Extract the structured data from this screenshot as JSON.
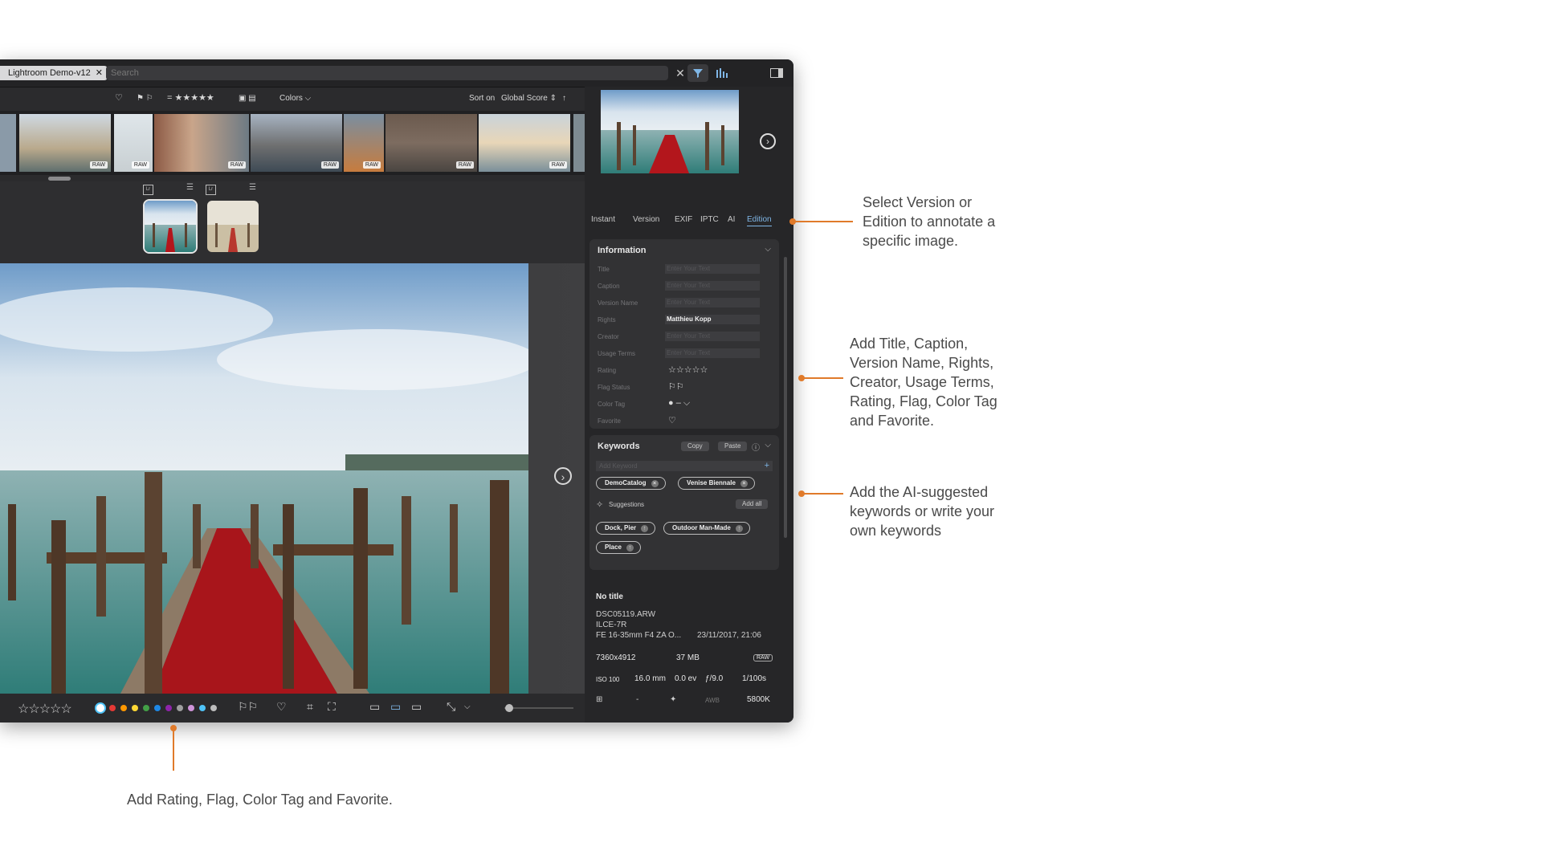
{
  "app": {
    "tab_label": "Lightroom Demo-v12",
    "search_placeholder": "Search"
  },
  "toolbar": {
    "rating_filter": "= ★★★★★",
    "colors_label": "Colors ⌵",
    "sort_label": "Sort on",
    "sort_value": "Global Score ⇕"
  },
  "filmstrip": {
    "raw_label": "RAW",
    "badge": "Lr"
  },
  "panel": {
    "tabs": [
      "Instant",
      "Version",
      "EXIF",
      "IPTC",
      "AI",
      "Edition"
    ],
    "active_tab": "Edition",
    "information": {
      "title": "Information",
      "fields": [
        {
          "label": "Title",
          "value": "Enter Your Text"
        },
        {
          "label": "Caption",
          "value": "Enter Your Text"
        },
        {
          "label": "Version Name",
          "value": "Enter Your Text"
        },
        {
          "label": "Rights",
          "value": "Matthieu Kopp"
        },
        {
          "label": "Creator",
          "value": "Enter Your Text"
        },
        {
          "label": "Usage Terms",
          "value": "Enter Your Text"
        }
      ],
      "rating_label": "Rating",
      "rating_value": "☆☆☆☆☆",
      "flag_label": "Flag Status",
      "color_label": "Color Tag",
      "color_value": "–",
      "favorite_label": "Favorite"
    },
    "keywords": {
      "title": "Keywords",
      "copy": "Copy",
      "paste": "Paste",
      "placeholder": "Add Keyword",
      "tags": [
        "DemoCatalog",
        "Venise Biennale"
      ],
      "suggestions_label": "Suggestions",
      "add_all": "Add all",
      "suggested": [
        "Dock, Pier",
        "Outdoor Man-Made",
        "Place"
      ]
    },
    "meta": {
      "title": "No title",
      "filename": "DSC05119.ARW",
      "camera": "ILCE-7R",
      "lens": "FE 16-35mm F4 ZA O...",
      "date": "23/11/2017, 21:06",
      "dimensions": "7360x4912",
      "size": "37 MB",
      "format": "RAW",
      "iso": "ISO 100",
      "focal": "16.0 mm",
      "ev": "0.0 ev",
      "aperture": "ƒ/9.0",
      "shutter": "1/100s",
      "dash": "-",
      "awb": "AWB",
      "wb": "5800K"
    }
  },
  "bottombar": {
    "stars": "☆☆☆☆☆",
    "color_dots": [
      "#ffffff",
      "#e53935",
      "#ff9800",
      "#fdd835",
      "#43a047",
      "#1e88e5",
      "#8e24aa",
      "#9e9e9e",
      "#ce93d8",
      "#4fc3f7",
      "#bdbdbd"
    ],
    "zoom_level": 0.05
  },
  "callouts": {
    "edition": "Select Version or Edition to annotate a specific image.",
    "fields": "Add Title, Caption, Version Name, Rights, Creator, Usage Terms, Rating, Flag, Color Tag and Favorite.",
    "keywords": "Add the AI-suggested keywords or write your own keywords",
    "bottom": "Add Rating, Flag, Color Tag and Favorite."
  },
  "colors": {
    "accent": "#e07a2a",
    "link": "#7fb6e6"
  }
}
